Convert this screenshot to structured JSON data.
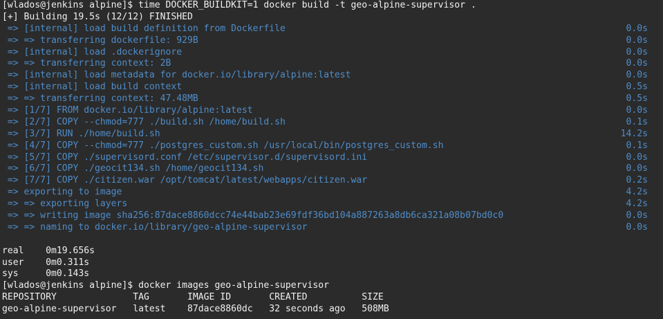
{
  "prompt1": "[wlados@jenkins alpine]$ time DOCKER_BUILDKIT=1 docker build -t geo-alpine-supervisor .",
  "build_status": "[+] Building 19.5s (12/12) FINISHED",
  "steps": [
    {
      "text": " => [internal] load build definition from Dockerfile",
      "time": "0.0s"
    },
    {
      "text": " => => transferring dockerfile: 929B",
      "time": "0.0s"
    },
    {
      "text": " => [internal] load .dockerignore",
      "time": "0.0s"
    },
    {
      "text": " => => transferring context: 2B",
      "time": "0.0s"
    },
    {
      "text": " => [internal] load metadata for docker.io/library/alpine:latest",
      "time": "0.0s"
    },
    {
      "text": " => [internal] load build context",
      "time": "0.5s"
    },
    {
      "text": " => => transferring context: 47.48MB",
      "time": "0.5s"
    },
    {
      "text": " => [1/7] FROM docker.io/library/alpine:latest",
      "time": "0.0s"
    },
    {
      "text": " => [2/7] COPY --chmod=777 ./build.sh /home/build.sh",
      "time": "0.1s"
    },
    {
      "text": " => [3/7] RUN ./home/build.sh",
      "time": "14.2s"
    },
    {
      "text": " => [4/7] COPY --chmod=777 ./postgres_custom.sh /usr/local/bin/postgres_custom.sh",
      "time": "0.1s"
    },
    {
      "text": " => [5/7] COPY ./supervisord.conf /etc/supervisor.d/supervisord.ini",
      "time": "0.0s"
    },
    {
      "text": " => [6/7] COPY ./geocit134.sh /home/geocit134.sh",
      "time": "0.0s"
    },
    {
      "text": " => [7/7] COPY ./citizen.war /opt/tomcat/latest/webapps/citizen.war",
      "time": "0.2s"
    },
    {
      "text": " => exporting to image",
      "time": "4.2s"
    },
    {
      "text": " => => exporting layers",
      "time": "4.2s"
    },
    {
      "text": " => => writing image sha256:87dace8860dcc74e44bab23e69fdf36bd104a887263a8db6ca321a08b07bd0c0",
      "time": "0.0s"
    },
    {
      "text": " => => naming to docker.io/library/geo-alpine-supervisor",
      "time": "0.0s"
    }
  ],
  "time_real": "real    0m19.656s",
  "time_user": "user    0m0.311s",
  "time_sys": "sys     0m0.143s",
  "prompt2": "[wlados@jenkins alpine]$ docker images geo-alpine-supervisor",
  "images_header": "REPOSITORY              TAG       IMAGE ID       CREATED          SIZE",
  "images_row": "geo-alpine-supervisor   latest    87dace8860dc   32 seconds ago   508MB",
  "colors": {
    "background": "#2b2b2b",
    "text": "#f0f0f0",
    "build_step": "#4f8dc9"
  }
}
